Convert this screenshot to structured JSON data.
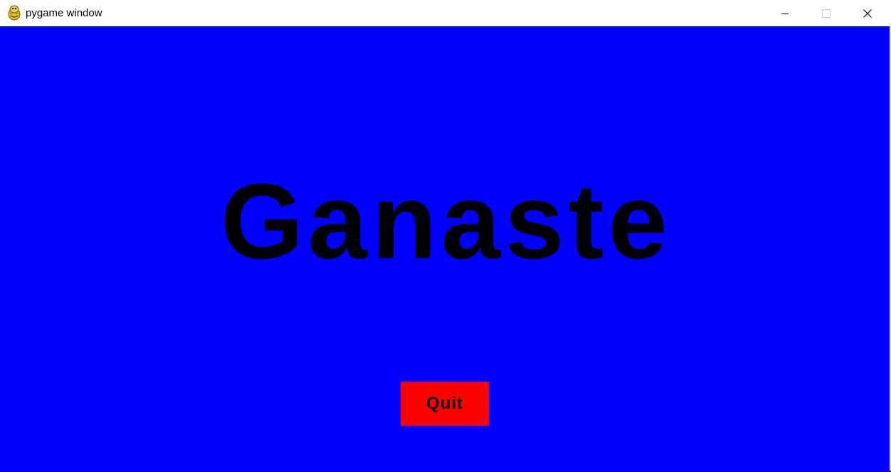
{
  "window": {
    "title": "pygame window",
    "icon": "pygame-snake-icon",
    "controls": {
      "minimize_icon": "minimize-icon",
      "maximize_icon": "maximize-icon",
      "close_icon": "close-icon"
    }
  },
  "game": {
    "background_color": "#0000ff",
    "headline": "Ganaste",
    "headline_color": "#000000",
    "quit_button": {
      "label": "Quit",
      "background_color": "#ff0000",
      "text_color": "#000000"
    }
  }
}
